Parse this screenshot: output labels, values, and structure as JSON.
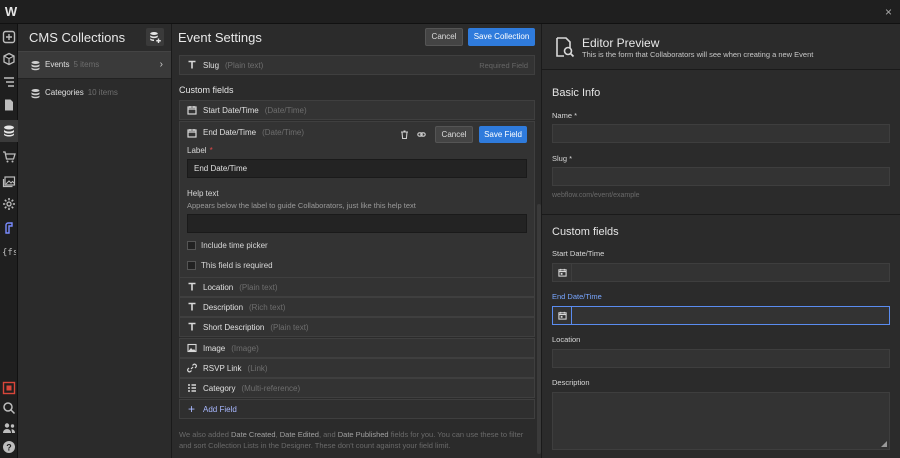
{
  "topbar": {
    "logo_text": "W",
    "close_glyph": "×"
  },
  "rail": {
    "icons": [
      "add-icon",
      "box-icon",
      "navigator-icon",
      "pages-icon",
      "cms-icon",
      "ecommerce-icon",
      "assets-icon",
      "settings-icon",
      "logic-icon",
      "finsweet-icon",
      "record-icon",
      "search-icon",
      "collaborators-icon",
      "help-icon"
    ]
  },
  "collections": {
    "title": "CMS Collections",
    "items": [
      {
        "label": "Events",
        "count": "5 items"
      },
      {
        "label": "Categories",
        "count": "10 items"
      }
    ]
  },
  "settings": {
    "title": "Event Settings",
    "cancel_label": "Cancel",
    "save_label": "Save Collection",
    "slug_field": {
      "name": "Slug",
      "type": "(Plain text)",
      "required": "Required Field"
    },
    "custom_heading": "Custom fields",
    "fields": [
      {
        "name": "Start Date/Time",
        "type": "(Date/Time)",
        "icon": "calendar-icon"
      },
      {
        "name": "Location",
        "type": "(Plain text)",
        "icon": "text-icon"
      },
      {
        "name": "Description",
        "type": "(Rich text)",
        "icon": "text-icon"
      },
      {
        "name": "Short Description",
        "type": "(Plain text)",
        "icon": "text-icon"
      },
      {
        "name": "Image",
        "type": "(Image)",
        "icon": "image-icon"
      },
      {
        "name": "RSVP Link",
        "type": "(Link)",
        "icon": "link-icon"
      },
      {
        "name": "Category",
        "type": "(Multi-reference)",
        "icon": "multi-reference-icon"
      }
    ],
    "editing": {
      "name": "End Date/Time",
      "type": "(Date/Time)",
      "cancel_label": "Cancel",
      "save_label": "Save Field",
      "label_label": "Label",
      "label_required": "*",
      "label_value": "End Date/Time",
      "help_label": "Help text",
      "help_desc": "Appears below the label to guide Collaborators, just like this help text",
      "help_value": "",
      "checkbox_time": "Include time picker",
      "checkbox_required": "This field is required"
    },
    "add_field_label": "Add Field",
    "footnote": {
      "pre": "We also added ",
      "b1": "Date Created",
      "s1": ", ",
      "b2": "Date Edited",
      "s2": ", and ",
      "b3": "Date Published",
      "post": " fields for you. You can use these to filter and sort Collection Lists in the Designer. These don't count against your field limit."
    }
  },
  "preview": {
    "title": "Editor Preview",
    "subtitle": "This is the form that Collaborators will see when creating a new Event",
    "basic_heading": "Basic Info",
    "name_label": "Name *",
    "slug_label": "Slug *",
    "slug_hint": "webflow.com/event/example",
    "custom_heading": "Custom fields",
    "start_label": "Start Date/Time",
    "end_label": "End Date/Time",
    "location_label": "Location",
    "description_label": "Description"
  },
  "colors": {
    "accent": "#2f7bdc",
    "required": "#e04848",
    "add_field": "#a8b8ff",
    "focus": "#5a8cf0"
  }
}
